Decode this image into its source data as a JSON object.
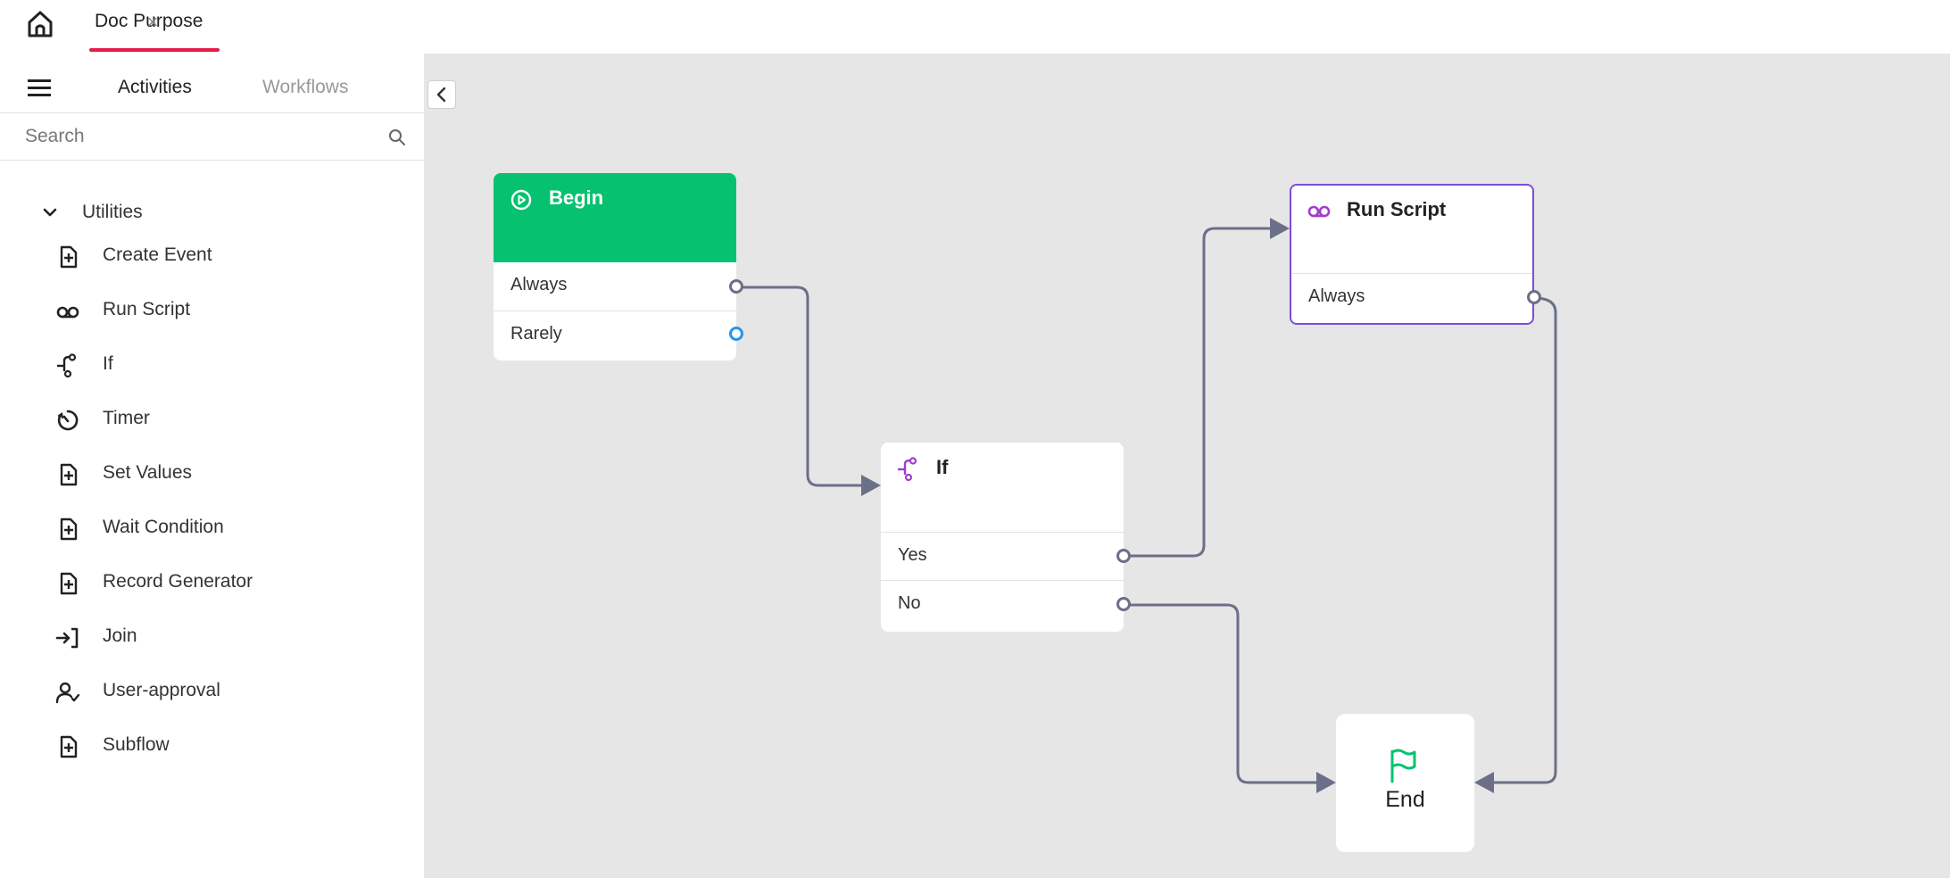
{
  "tabs": [
    {
      "label": "Doc Purpose",
      "close": "×"
    }
  ],
  "sidebar": {
    "tabs": {
      "activities": "Activities",
      "workflows": "Workflows"
    },
    "search": {
      "placeholder": "Search",
      "value": ""
    },
    "group": "Utilities",
    "items": [
      {
        "label": "Create Event",
        "icon": "file-plus-icon"
      },
      {
        "label": "Run Script",
        "icon": "voicemail-icon"
      },
      {
        "label": "If",
        "icon": "branch-icon"
      },
      {
        "label": "Timer",
        "icon": "timer-icon"
      },
      {
        "label": "Set Values",
        "icon": "file-plus-icon"
      },
      {
        "label": "Wait Condition",
        "icon": "file-plus-icon"
      },
      {
        "label": "Record Generator",
        "icon": "file-plus-icon"
      },
      {
        "label": "Join",
        "icon": "join-icon"
      },
      {
        "label": "User-approval",
        "icon": "user-check-icon"
      },
      {
        "label": "Subflow",
        "icon": "file-plus-icon"
      }
    ]
  },
  "canvas": {
    "nodes": {
      "begin": {
        "title": "Begin",
        "outputs": [
          "Always",
          "Rarely"
        ]
      },
      "if": {
        "title": "If",
        "outputs": [
          "Yes",
          "No"
        ]
      },
      "run_script": {
        "title": "Run Script",
        "outputs": [
          "Always"
        ]
      },
      "end": {
        "title": "End"
      }
    }
  },
  "colors": {
    "accent": "#e11d48",
    "begin": "#06c270",
    "script_border": "#7c4ddb",
    "icon_purple": "#a13ccf",
    "wire": "#6b6f88",
    "port_active": "#2196f3",
    "canvas_bg": "#e6e6e6"
  }
}
